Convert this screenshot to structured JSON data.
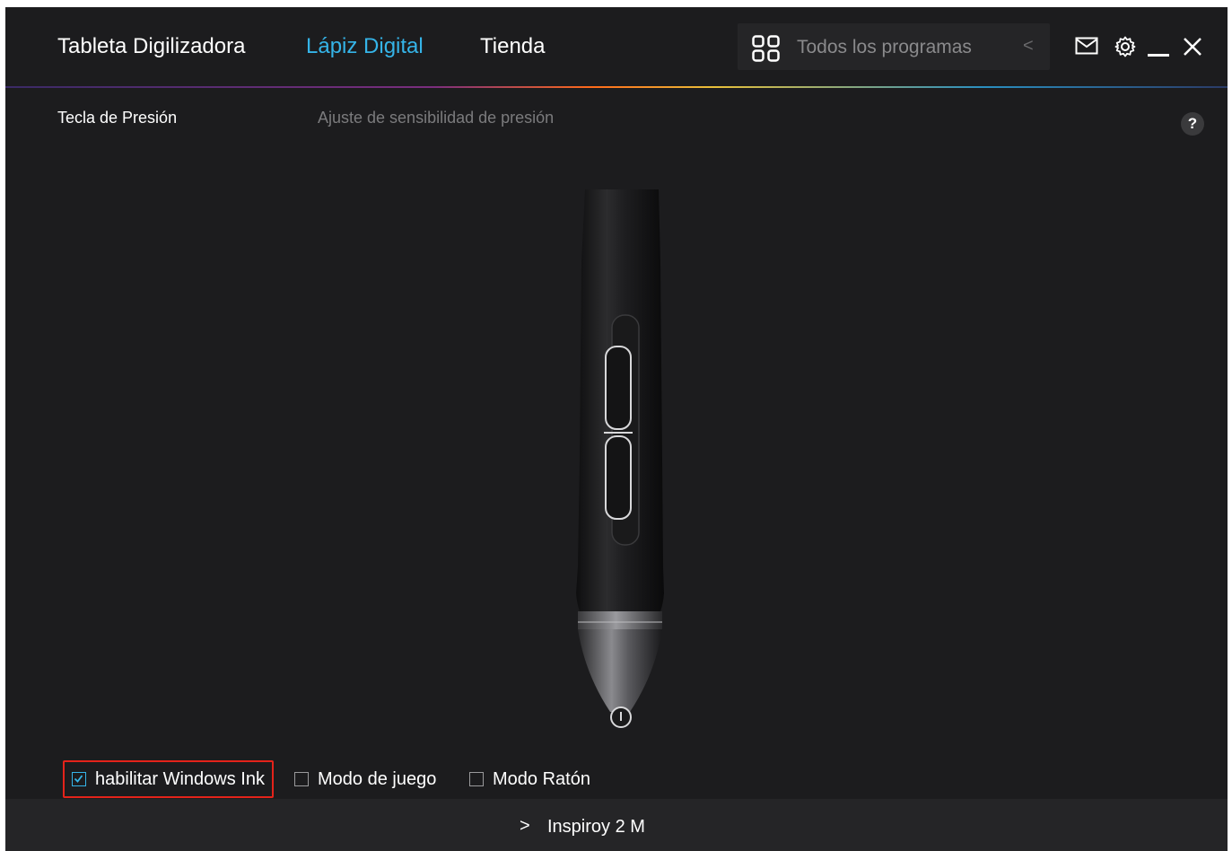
{
  "nav": {
    "tabs": [
      {
        "label": "Tableta Digilizadora",
        "active": false
      },
      {
        "label": "Lápiz Digital",
        "active": true
      },
      {
        "label": "Tienda",
        "active": false
      }
    ],
    "accent_color": "#35b4e8"
  },
  "programs": {
    "icon": "grid-icon",
    "label": "Todos los programas",
    "chevron": "<"
  },
  "window_controls": {
    "mail": "mail-icon",
    "settings": "gear-icon",
    "minimize": "minimize-icon",
    "close": "close-icon"
  },
  "section": {
    "title": "Tecla de Presión",
    "subtitle": "Ajuste de sensibilidad de presión",
    "help": "?"
  },
  "options": [
    {
      "label": "habilitar Windows Ink",
      "checked": true,
      "highlighted": true
    },
    {
      "label": "Modo de juego",
      "checked": false
    },
    {
      "label": "Modo Ratón",
      "checked": false
    }
  ],
  "device": {
    "chevron": ">",
    "name": "Inspiroy 2 M"
  },
  "colors": {
    "background": "#1c1c1e",
    "highlight_border": "#e4231a"
  }
}
